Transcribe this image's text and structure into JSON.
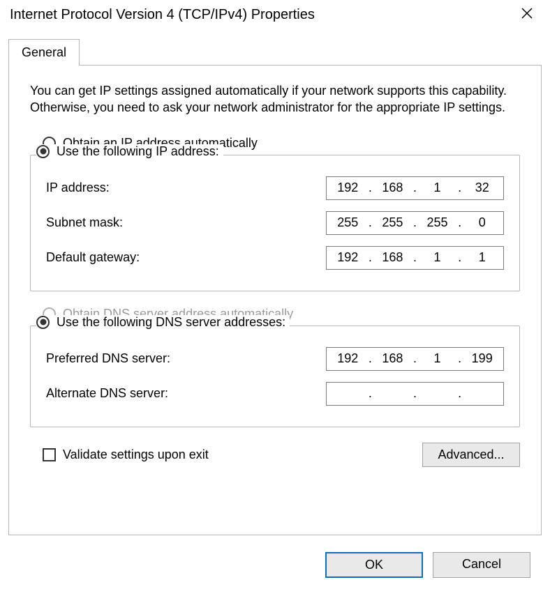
{
  "window": {
    "title": "Internet Protocol Version 4 (TCP/IPv4) Properties"
  },
  "tabs": {
    "general": "General"
  },
  "intro": "You can get IP settings assigned automatically if your network supports this capability. Otherwise, you need to ask your network administrator for the appropriate IP settings.",
  "ip": {
    "radio_auto": "Obtain an IP address automatically",
    "radio_manual": "Use the following IP address:",
    "ipaddr_label": "IP address:",
    "ipaddr": {
      "o1": "192",
      "o2": "168",
      "o3": "1",
      "o4": "32"
    },
    "subnet_label": "Subnet mask:",
    "subnet": {
      "o1": "255",
      "o2": "255",
      "o3": "255",
      "o4": "0"
    },
    "gateway_label": "Default gateway:",
    "gateway": {
      "o1": "192",
      "o2": "168",
      "o3": "1",
      "o4": "1"
    }
  },
  "dns": {
    "radio_auto": "Obtain DNS server address automatically",
    "radio_manual": "Use the following DNS server addresses:",
    "pref_label": "Preferred DNS server:",
    "pref": {
      "o1": "192",
      "o2": "168",
      "o3": "1",
      "o4": "199"
    },
    "alt_label": "Alternate DNS server:",
    "alt": {
      "o1": "",
      "o2": "",
      "o3": "",
      "o4": ""
    }
  },
  "validate": "Validate settings upon exit",
  "buttons": {
    "advanced": "Advanced...",
    "ok": "OK",
    "cancel": "Cancel"
  }
}
